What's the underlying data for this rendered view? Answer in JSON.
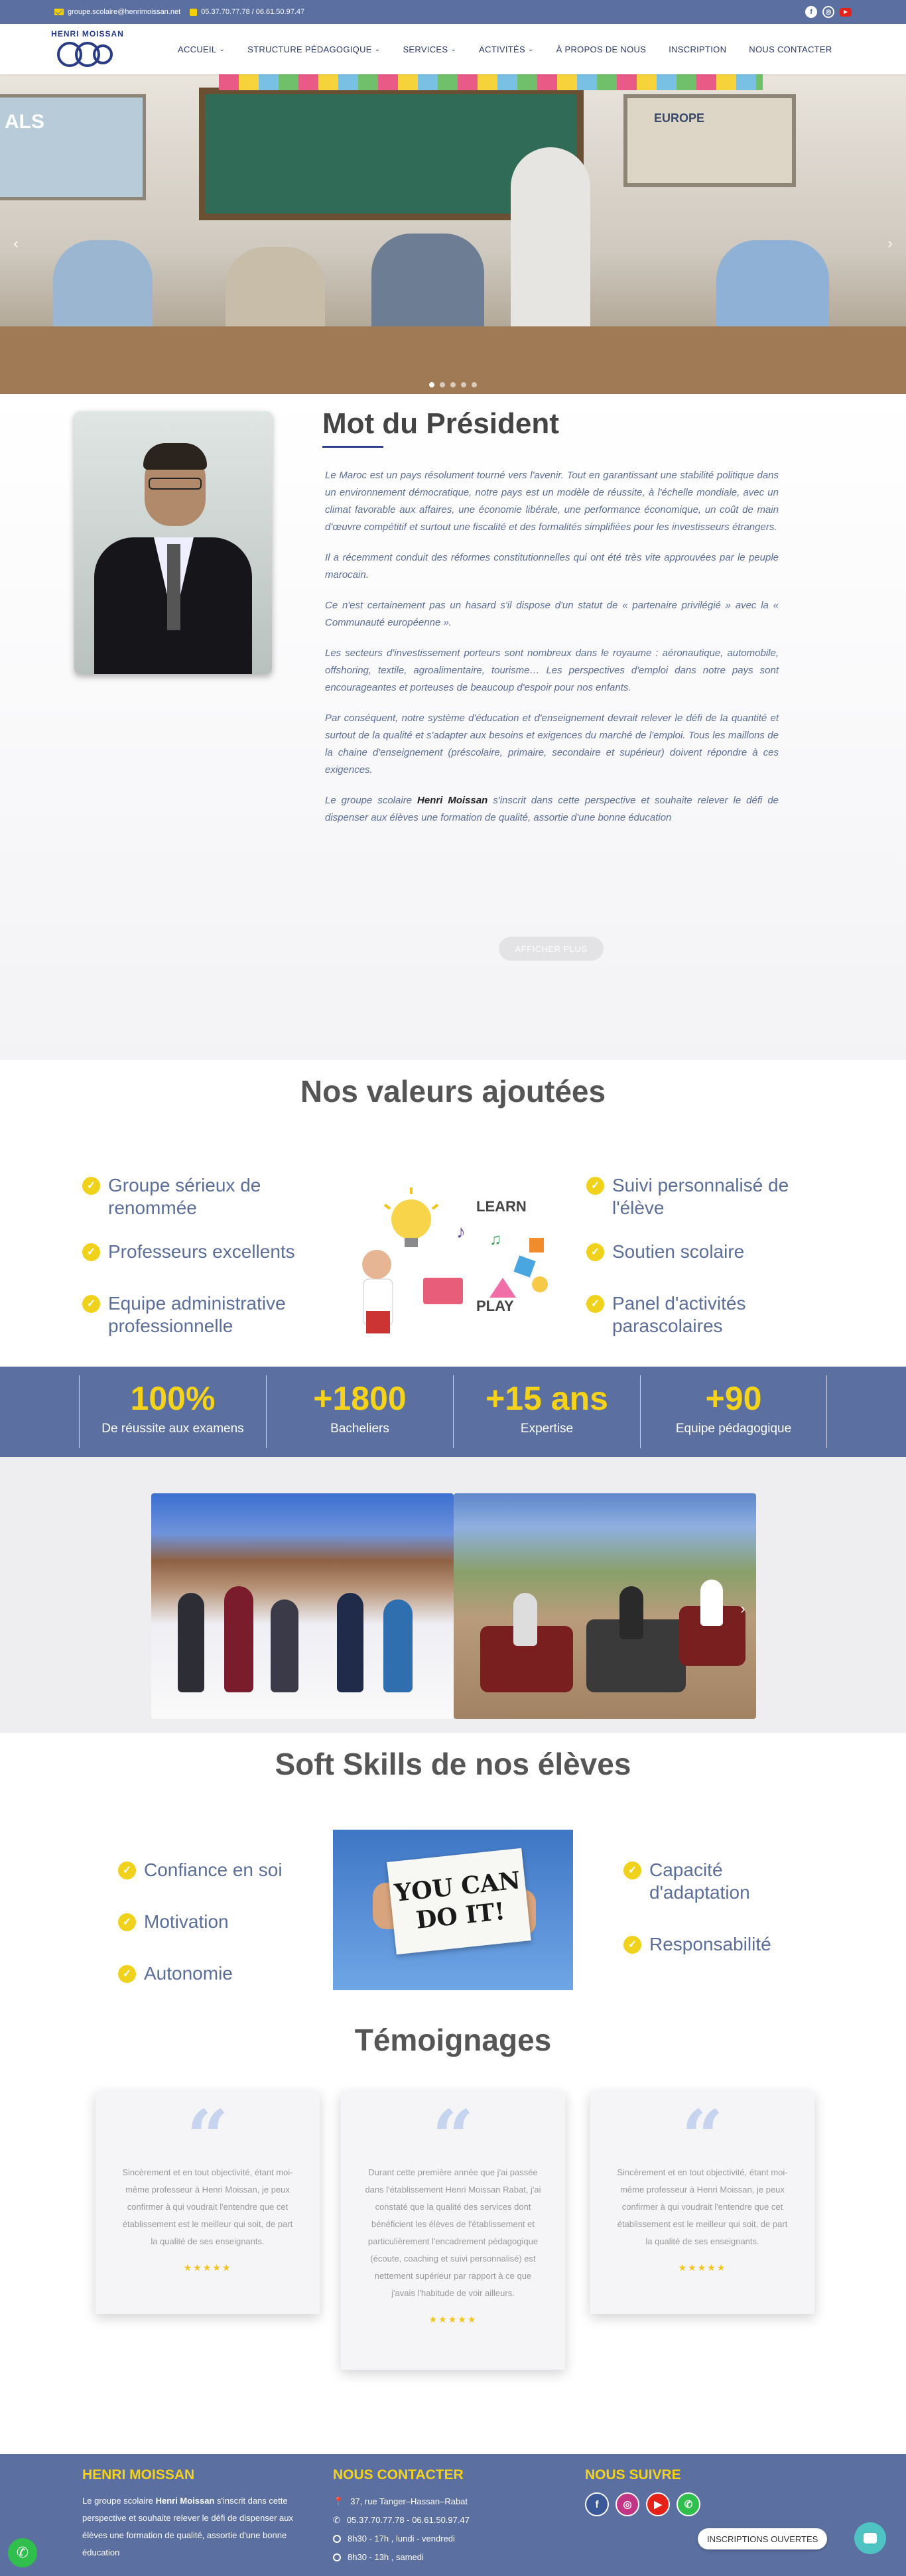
{
  "topbar": {
    "email": "groupe.scolaire@henrimoissan.net",
    "phones": "05.37.70.77.78 / 06.61.50.97.47",
    "socials": [
      "facebook-icon",
      "instagram-icon",
      "youtube-icon"
    ]
  },
  "logo": {
    "text": "HENRI MOISSAN"
  },
  "nav": {
    "items": [
      {
        "label": "ACCUEIL",
        "dropdown": true
      },
      {
        "label": "STRUCTURE PÉDAGOGIQUE",
        "dropdown": true
      },
      {
        "label": "SERVICES",
        "dropdown": true
      },
      {
        "label": "ACTIVITÉS",
        "dropdown": true
      },
      {
        "label": "À PROPOS DE NOUS",
        "dropdown": false
      },
      {
        "label": "INSCRIPTION",
        "dropdown": false
      },
      {
        "label": "NOUS CONTACTER",
        "dropdown": false
      }
    ]
  },
  "hero": {
    "board_left": "ALS",
    "board_right": "EUROPE",
    "slides": 5,
    "active_slide": 1
  },
  "president": {
    "title": "Mot du Président",
    "paragraphs": [
      "Le Maroc est un pays résolument tourné vers l'avenir. Tout en garantissant une stabilité politique dans un environnement démocratique, notre pays est un modèle de réussite, à l'échelle mondiale, avec un climat favorable aux affaires, une économie libérale, une performance économique, un coût de main d'œuvre compétitif et surtout une fiscalité et des formalités simplifiées pour les investisseurs étrangers.",
      "Il a récemment conduit des réformes constitutionnelles qui ont été très vite approuvées par le peuple marocain.",
      "Ce n'est certainement pas un hasard s'il dispose d'un statut de « partenaire privilégié » avec la « Communauté européenne ».",
      "Les secteurs d'investissement porteurs sont nombreux dans le royaume : aéronautique, automobile, offshoring, textile, agroalimentaire, tourisme… Les perspectives d'emploi dans notre pays sont encourageantes et porteuses de beaucoup d'espoir pour nos enfants.",
      "Par conséquent, notre système d'éducation et d'enseignement devrait relever le défi de la quantité et surtout de la qualité et s'adapter aux besoins et exigences du marché de l'emploi. Tous les maillons de la chaine d'enseignement (préscolaire, primaire, secondaire et supérieur) doivent répondre à ces exigences."
    ],
    "last_pre": "Le groupe scolaire ",
    "last_bold": "Henri Moissan",
    "last_post": " s'inscrit dans cette perspective et souhaite relever le défi de dispenser aux élèves une formation de qualité, assortie d'une bonne éducation",
    "more_button": "AFFICHER PLUS"
  },
  "values": {
    "title": "Nos valeurs ajoutées",
    "left": [
      "Groupe sérieux de renommée",
      "Professeurs excellents",
      "Equipe administrative professionnelle"
    ],
    "right": [
      "Suivi personnalisé de l'élève",
      "Soutien scolaire",
      "Panel d'activités parascolaires"
    ],
    "image_words": [
      "LEARN",
      "PLAY"
    ]
  },
  "stats": [
    {
      "num": "100%",
      "label": "De réussite aux examens"
    },
    {
      "num": "+1800",
      "label": "Bacheliers"
    },
    {
      "num": "+15 ans",
      "label": "Expertise"
    },
    {
      "num": "+90",
      "label": "Equipe pédagogique"
    }
  ],
  "soft": {
    "title": "Soft Skills de nos élèves",
    "left": [
      "Confiance en soi",
      "Motivation",
      "Autonomie"
    ],
    "right": [
      "Capacité d'adaptation",
      "Responsabilité"
    ],
    "sign_line1": "YOU CAN",
    "sign_line2": "DO IT!"
  },
  "testimonials": {
    "title": "Témoignages",
    "items": [
      {
        "text": "Sincèrement et en tout objectivité, étant moi-même professeur à Henri Moissan, je peux confirmer à qui voudrait l'entendre que cet établissement est le meilleur qui soit, de part la qualité de ses enseignants.",
        "stars": "★★★★★"
      },
      {
        "text": "Durant cette première année que j'ai passée dans l'établissement Henri Moissan Rabat, j'ai constaté que la qualité des services dont bénéficient les élèves de l'établissement et particulièrement l'encadrement pédagogique (écoute, coaching et suivi personnalisé) est nettement supérieur par rapport à ce que j'avais l'habitude de voir ailleurs.",
        "stars": "★★★★★"
      },
      {
        "text": "Sincèrement et en tout objectivité, étant moi-même professeur à Henri Moissan, je peux confirmer à qui voudrait l'entendre que cet établissement est le meilleur qui soit, de part la qualité de ses enseignants.",
        "stars": "★★★★★"
      }
    ]
  },
  "footer": {
    "col1_title": "HENRI MOISSAN",
    "col1_pre": "Le groupe scolaire ",
    "col1_bold": "Henri Moissan",
    "col1_post": " s'inscrit dans cette perspective et souhaite relever le défi de dispenser aux élèves une formation de qualité, assortie d'une bonne éducation",
    "col2_title": "NOUS CONTACTER",
    "address": "37, rue Tanger–Hassan–Rabat",
    "phone": "05.37.70.77.78 - 06.61.50.97.47",
    "hours1": "8h30 - 17h , lundi - vendredi",
    "hours2": "8h30 - 13h , samedi",
    "col3_title": "NOUS SUIVRE",
    "socials": [
      "facebook-icon",
      "instagram-icon",
      "youtube-icon",
      "whatsapp-icon"
    ]
  },
  "floating": {
    "inscriptions": "INSCRIPTIONS OUVERTES"
  },
  "colors": {
    "primary": "#5b6fa0",
    "accent": "#f5d31a",
    "text_blue": "#5b6e9a"
  }
}
